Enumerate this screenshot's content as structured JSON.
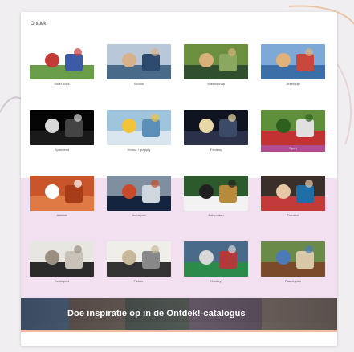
{
  "card": {
    "title": "Ontdek!"
  },
  "tiles": [
    {
      "label": "Soort boek",
      "colors": [
        "#ffffff",
        "#6a9d4a",
        "#c43a36",
        "#3c5aa5"
      ]
    },
    {
      "label": "School",
      "colors": [
        "#b9c8d8",
        "#4a6a8a",
        "#d8b08a",
        "#2c4a6b"
      ]
    },
    {
      "label": "Vriendschap",
      "colors": [
        "#6b8f3f",
        "#2f4f2f",
        "#d9b07a",
        "#8aa860"
      ]
    },
    {
      "label": "Jezelf zijn",
      "colors": [
        "#7ea9d6",
        "#3c6fa8",
        "#e0b27a",
        "#c9473d"
      ]
    },
    {
      "label": "Spannend",
      "colors": [
        "#050505",
        "#1a1a1a",
        "#d8d8d8",
        "#444444"
      ]
    },
    {
      "label": "Humor / grappig",
      "colors": [
        "#9fc4de",
        "#d9e6ef",
        "#f2c43a",
        "#5b8fb8"
      ]
    },
    {
      "label": "Fantasy",
      "colors": [
        "#0f1420",
        "#2a3148",
        "#e8d8a8",
        "#3b4a66"
      ]
    },
    {
      "label": "Sport",
      "colors": [
        "#5f8f3a",
        "#c23232",
        "#2d5f1e",
        "#e0e0e0"
      ],
      "active": true
    },
    {
      "label": "Atletiek",
      "colors": [
        "#c8562a",
        "#e07a45",
        "#ffffff",
        "#a63c18"
      ]
    },
    {
      "label": "Autosport",
      "colors": [
        "#7f8f9f",
        "#14233e",
        "#c84a2a",
        "#cfd6de"
      ]
    },
    {
      "label": "Balsporten",
      "colors": [
        "#2c5a2c",
        "#f2f2f2",
        "#202020",
        "#b88a3c"
      ]
    },
    {
      "label": "Dansen",
      "colors": [
        "#3b2f2a",
        "#c23a3a",
        "#e6c8a6",
        "#1f6fa6"
      ]
    },
    {
      "label": "Denksport",
      "colors": [
        "#e8e6e0",
        "#2a2a2a",
        "#9a8f80",
        "#c8c2b8"
      ]
    },
    {
      "label": "Fietsen",
      "colors": [
        "#f0eee8",
        "#333333",
        "#c8b89a",
        "#888888"
      ]
    },
    {
      "label": "Hockey",
      "colors": [
        "#4a6a8a",
        "#2c8a4a",
        "#d8d8d8",
        "#b23a3a"
      ]
    },
    {
      "label": "Paardrijden",
      "colors": [
        "#6a8a4a",
        "#7a4a2a",
        "#4a7ab8",
        "#d8c8a8"
      ]
    }
  ],
  "banner": {
    "text": "Doe inspiratie op in de Ontdek!-catalogus"
  },
  "accent": "#b24b8f",
  "background": "#f1eef2"
}
